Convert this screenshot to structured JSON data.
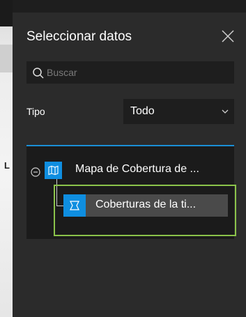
{
  "panel": {
    "title": "Seleccionar datos",
    "close_icon": "close-icon"
  },
  "search": {
    "placeholder": "Buscar",
    "value": "",
    "icon": "search-icon"
  },
  "type_filter": {
    "label": "Tipo",
    "selected": "Todo",
    "icon": "chevron-down-icon"
  },
  "tree": {
    "parent": {
      "label": "Mapa de Cobertura de ...",
      "icon": "map-icon",
      "expand_icon": "collapse-icon"
    },
    "child": {
      "label": "Coberturas de la ti...",
      "icon": "layer-icon"
    }
  },
  "map_background": {
    "letter": "L"
  },
  "colors": {
    "panel_bg": "#2b2b2b",
    "input_bg": "#1e1e1e",
    "accent": "#0f8ee0",
    "tree_border": "#1a8fd6",
    "child_row_bg": "#4a4a4a",
    "highlight": "#8bc34a"
  }
}
